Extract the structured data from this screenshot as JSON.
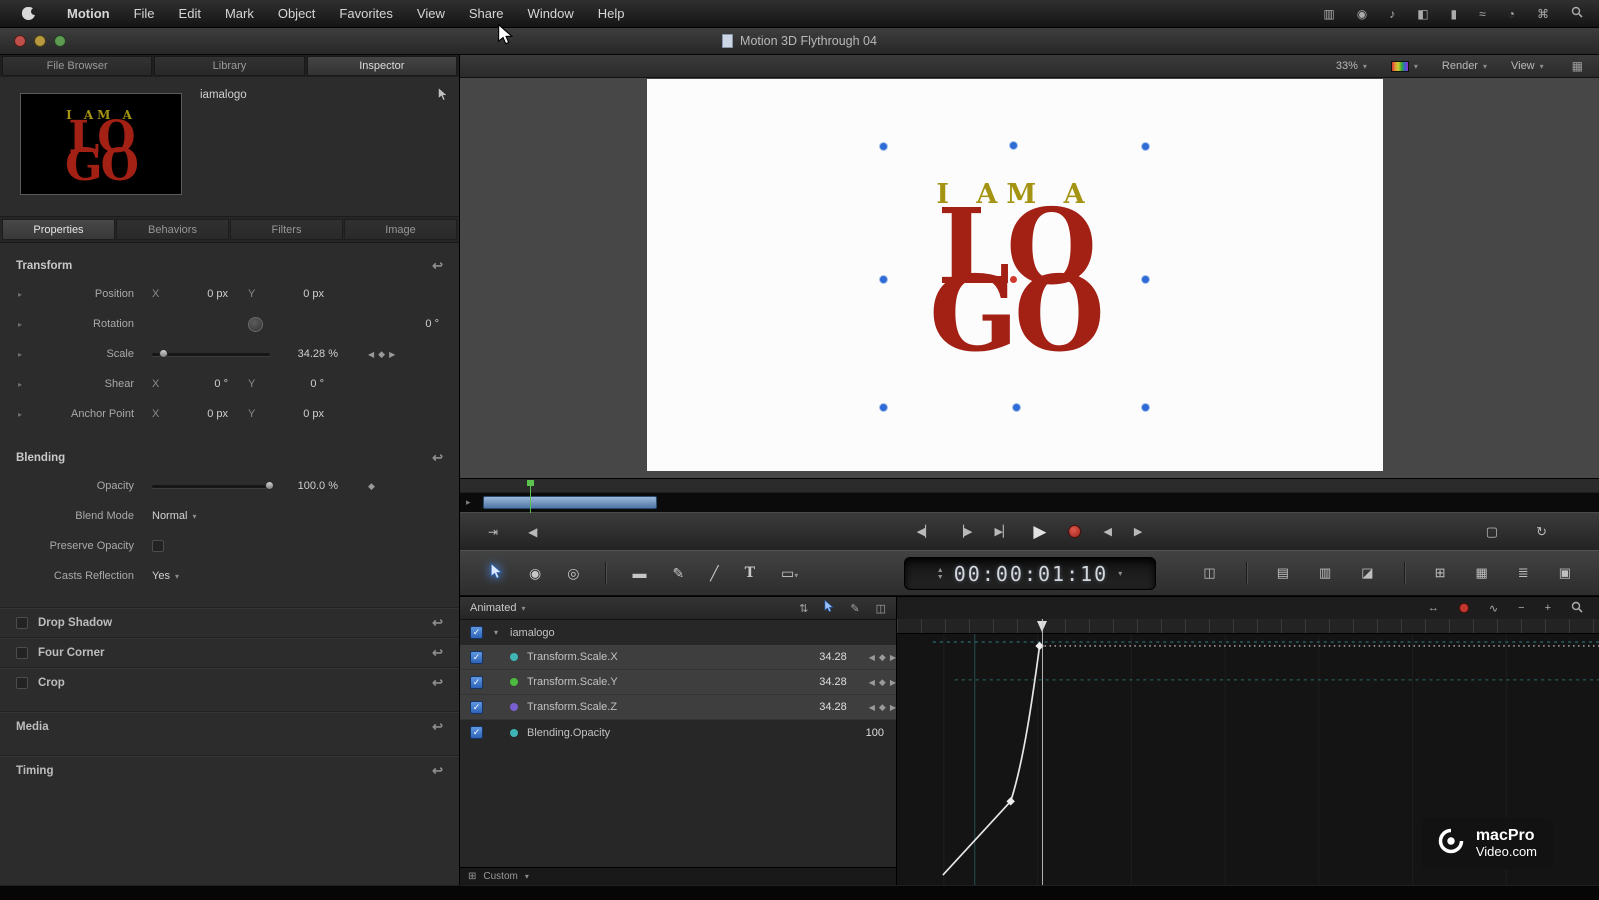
{
  "menubar": {
    "app": "Motion",
    "items": [
      "File",
      "Edit",
      "Mark",
      "Object",
      "Favorites",
      "View",
      "Share",
      "Window",
      "Help"
    ],
    "status_icons": [
      "display-icon",
      "shield-icon",
      "notifications-icon",
      "volume-icon",
      "battery-icon",
      "network-icon",
      "clock-icon",
      "switcher-icon",
      "spotlight-icon"
    ]
  },
  "window": {
    "title": "Motion 3D Flythrough 04"
  },
  "inspector": {
    "tabs": {
      "file_browser": "File Browser",
      "library": "Library",
      "inspector": "Inspector"
    },
    "preview": {
      "name": "iamalogo"
    },
    "subtabs": {
      "properties": "Properties",
      "behaviors": "Behaviors",
      "filters": "Filters",
      "image": "Image"
    },
    "transform": {
      "title": "Transform",
      "position": {
        "label": "Position",
        "xk": "X",
        "xv": "0 px",
        "yk": "Y",
        "yv": "0 px"
      },
      "rotation": {
        "label": "Rotation",
        "value": "0 °"
      },
      "scale": {
        "label": "Scale",
        "value": "34.28 %"
      },
      "shear": {
        "label": "Shear",
        "xk": "X",
        "xv": "0 °",
        "yk": "Y",
        "yv": "0 °"
      },
      "anchor": {
        "label": "Anchor Point",
        "xk": "X",
        "xv": "0 px",
        "yk": "Y",
        "yv": "0 px"
      }
    },
    "blending": {
      "title": "Blending",
      "opacity_label": "Opacity",
      "opacity_value": "100.0 %",
      "blend_mode_label": "Blend Mode",
      "blend_mode_value": "Normal",
      "preserve_opacity_label": "Preserve Opacity",
      "casts_reflection_label": "Casts Reflection",
      "casts_reflection_value": "Yes"
    },
    "collapsed": {
      "drop_shadow": "Drop Shadow",
      "four_corner": "Four Corner",
      "crop": "Crop",
      "media": "Media",
      "timing": "Timing"
    }
  },
  "canvas": {
    "zoom": "33%",
    "render": "Render",
    "view": "View",
    "logo": {
      "top": "I AM A",
      "line1": "LO",
      "line2": "GO"
    }
  },
  "transport": {
    "timecode": "00:00:01:10"
  },
  "keyframe_editor": {
    "header": "Animated",
    "group": "iamalogo",
    "rows": [
      {
        "name": "Transform.Scale.X",
        "value": "34.28",
        "color": "#3fb5b5"
      },
      {
        "name": "Transform.Scale.Y",
        "value": "34.28",
        "color": "#4cbb3f"
      },
      {
        "name": "Transform.Scale.Z",
        "value": "34.28",
        "color": "#7a5fd0"
      },
      {
        "name": "Blending.Opacity",
        "value": "100",
        "color": "#3fb5b5"
      }
    ],
    "footer": "Custom"
  },
  "watermark": {
    "line1": "macPro",
    "line2": "Video.com"
  },
  "colors": {
    "accent_blue": "#3f7fd6",
    "record_red": "#c4372c",
    "logo_red": "#a32015",
    "logo_yellow": "#a59413",
    "timeline_bar_blue": "#6f94bd"
  }
}
